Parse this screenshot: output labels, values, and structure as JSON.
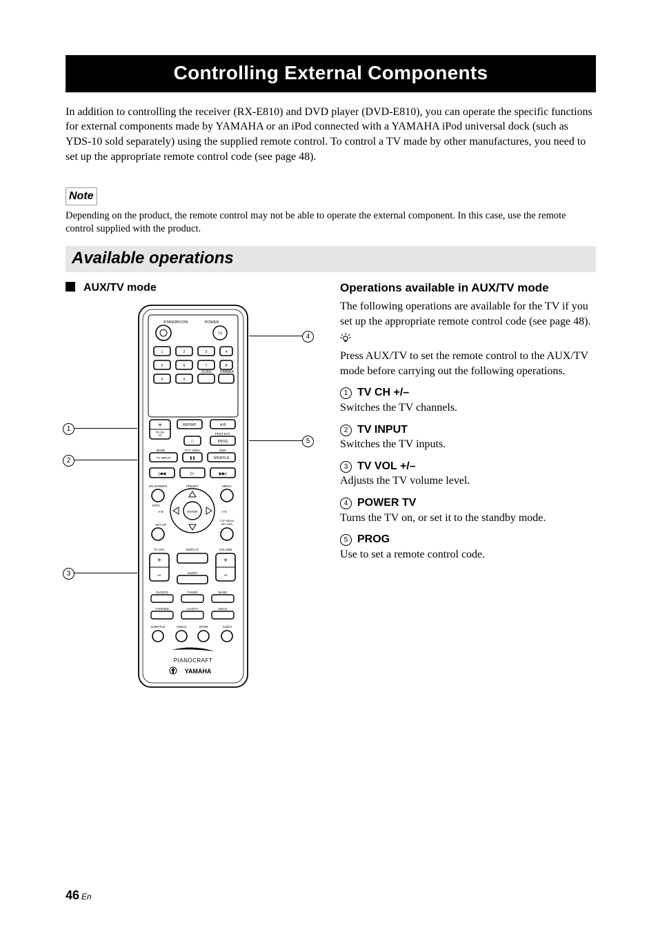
{
  "title": "Controlling External Components",
  "intro": "In addition to controlling the receiver (RX-E810) and DVD player (DVD-E810), you can operate the specific functions for external components made by YAMAHA or an iPod connected with a YAMAHA iPod universal dock (such as YDS-10 sold separately) using the supplied remote control. To control a TV made by other manufactures, you need to set up the appropriate remote control code (see page 48).",
  "note_label": "Note",
  "note_text": "Depending on the product, the remote control may not be able to operate the external component. In this case, use the remote control supplied with the product.",
  "section_title": "Available operations",
  "left": {
    "mode_heading": "AUX/TV mode",
    "callouts": {
      "c1": "1",
      "c2": "2",
      "c3": "3",
      "c4": "4",
      "c5": "5"
    },
    "remote": {
      "labels": {
        "standby_on": "STANDBY/ON",
        "power": "POWER",
        "tv": "TV",
        "scan": "SCAN",
        "dimmer": "DIMMER",
        "repeat": "REPEAT",
        "a_b": "A-B",
        "tv_ch": "TV CH",
        "prst_ext": "PRST EXT.",
        "prog": "PROG",
        "mode": "MODE",
        "ptypseek": "P.TY. SEEK",
        "rdm": "RDM",
        "tv_input": "TV INPUT",
        "pause_icon": "❚❚",
        "shuffle": "SHUFFLE",
        "on_screen": "ON SCREEN",
        "preset": "PRESET",
        "menu": "MENU",
        "info": "INFO",
        "ae_left": "A-E",
        "enter": "ENTER",
        "ae_right": "A-E",
        "top_menu": "TOP MENU",
        "return": "RETURN",
        "set_up": "SET UP",
        "tv_vol": "TV VOL",
        "display": "DISPLAY",
        "volume": "VOLUME",
        "sleep": "SLEEP",
        "dvd_cd": "DVD/CD",
        "tuner": "TUNER",
        "band": "BAND",
        "tape_md": "TAPE/MD",
        "aux_tv": "AUX/TV",
        "dock": "DOCK",
        "subtitle": "SUBTITLE",
        "angle": "ANGLE",
        "zoom": "ZOOM",
        "audio": "AUDIO",
        "brand1": "PIANOCRAFT",
        "brand2": "YAMAHA",
        "num1": "1",
        "num2": "2",
        "num3": "3",
        "num4": "4",
        "num5": "5",
        "num6": "6",
        "num7": "7",
        "num8": "8",
        "num9": "9",
        "num0": "0"
      }
    }
  },
  "right": {
    "ops_heading": "Operations available in AUX/TV mode",
    "ops_intro": "The following operations are available for the TV if you set up the appropriate remote control code (see page 48).",
    "tip_text": "Press AUX/TV to set the remote control to the AUX/TV mode before carrying out the following operations.",
    "items": [
      {
        "num": "1",
        "label": "TV CH +/–",
        "desc": "Switches the TV channels."
      },
      {
        "num": "2",
        "label": "TV INPUT",
        "desc": "Switches the TV inputs."
      },
      {
        "num": "3",
        "label": "TV VOL +/–",
        "desc": "Adjusts the TV volume level."
      },
      {
        "num": "4",
        "label": "POWER TV",
        "desc": "Turns the TV on, or set it to the standby mode."
      },
      {
        "num": "5",
        "label": "PROG",
        "desc": "Use to set a remote control code."
      }
    ]
  },
  "page_number": "46",
  "page_lang": "En"
}
